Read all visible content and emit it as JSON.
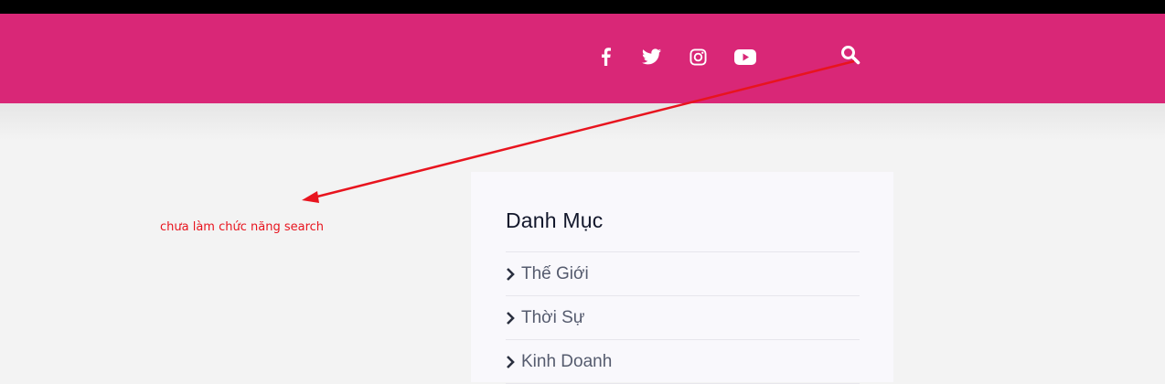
{
  "header": {
    "background_color": "#d92777",
    "social_icons": [
      "facebook-icon",
      "twitter-icon",
      "instagram-icon",
      "youtube-icon"
    ],
    "search_icon": "search-icon"
  },
  "annotation": {
    "text": "chưa làm chức năng search",
    "color": "#e8141e"
  },
  "sidebar_widget": {
    "title": "Danh Mục",
    "categories": [
      {
        "label": "Thế Giới"
      },
      {
        "label": "Thời Sự"
      },
      {
        "label": "Kinh Doanh"
      }
    ]
  }
}
